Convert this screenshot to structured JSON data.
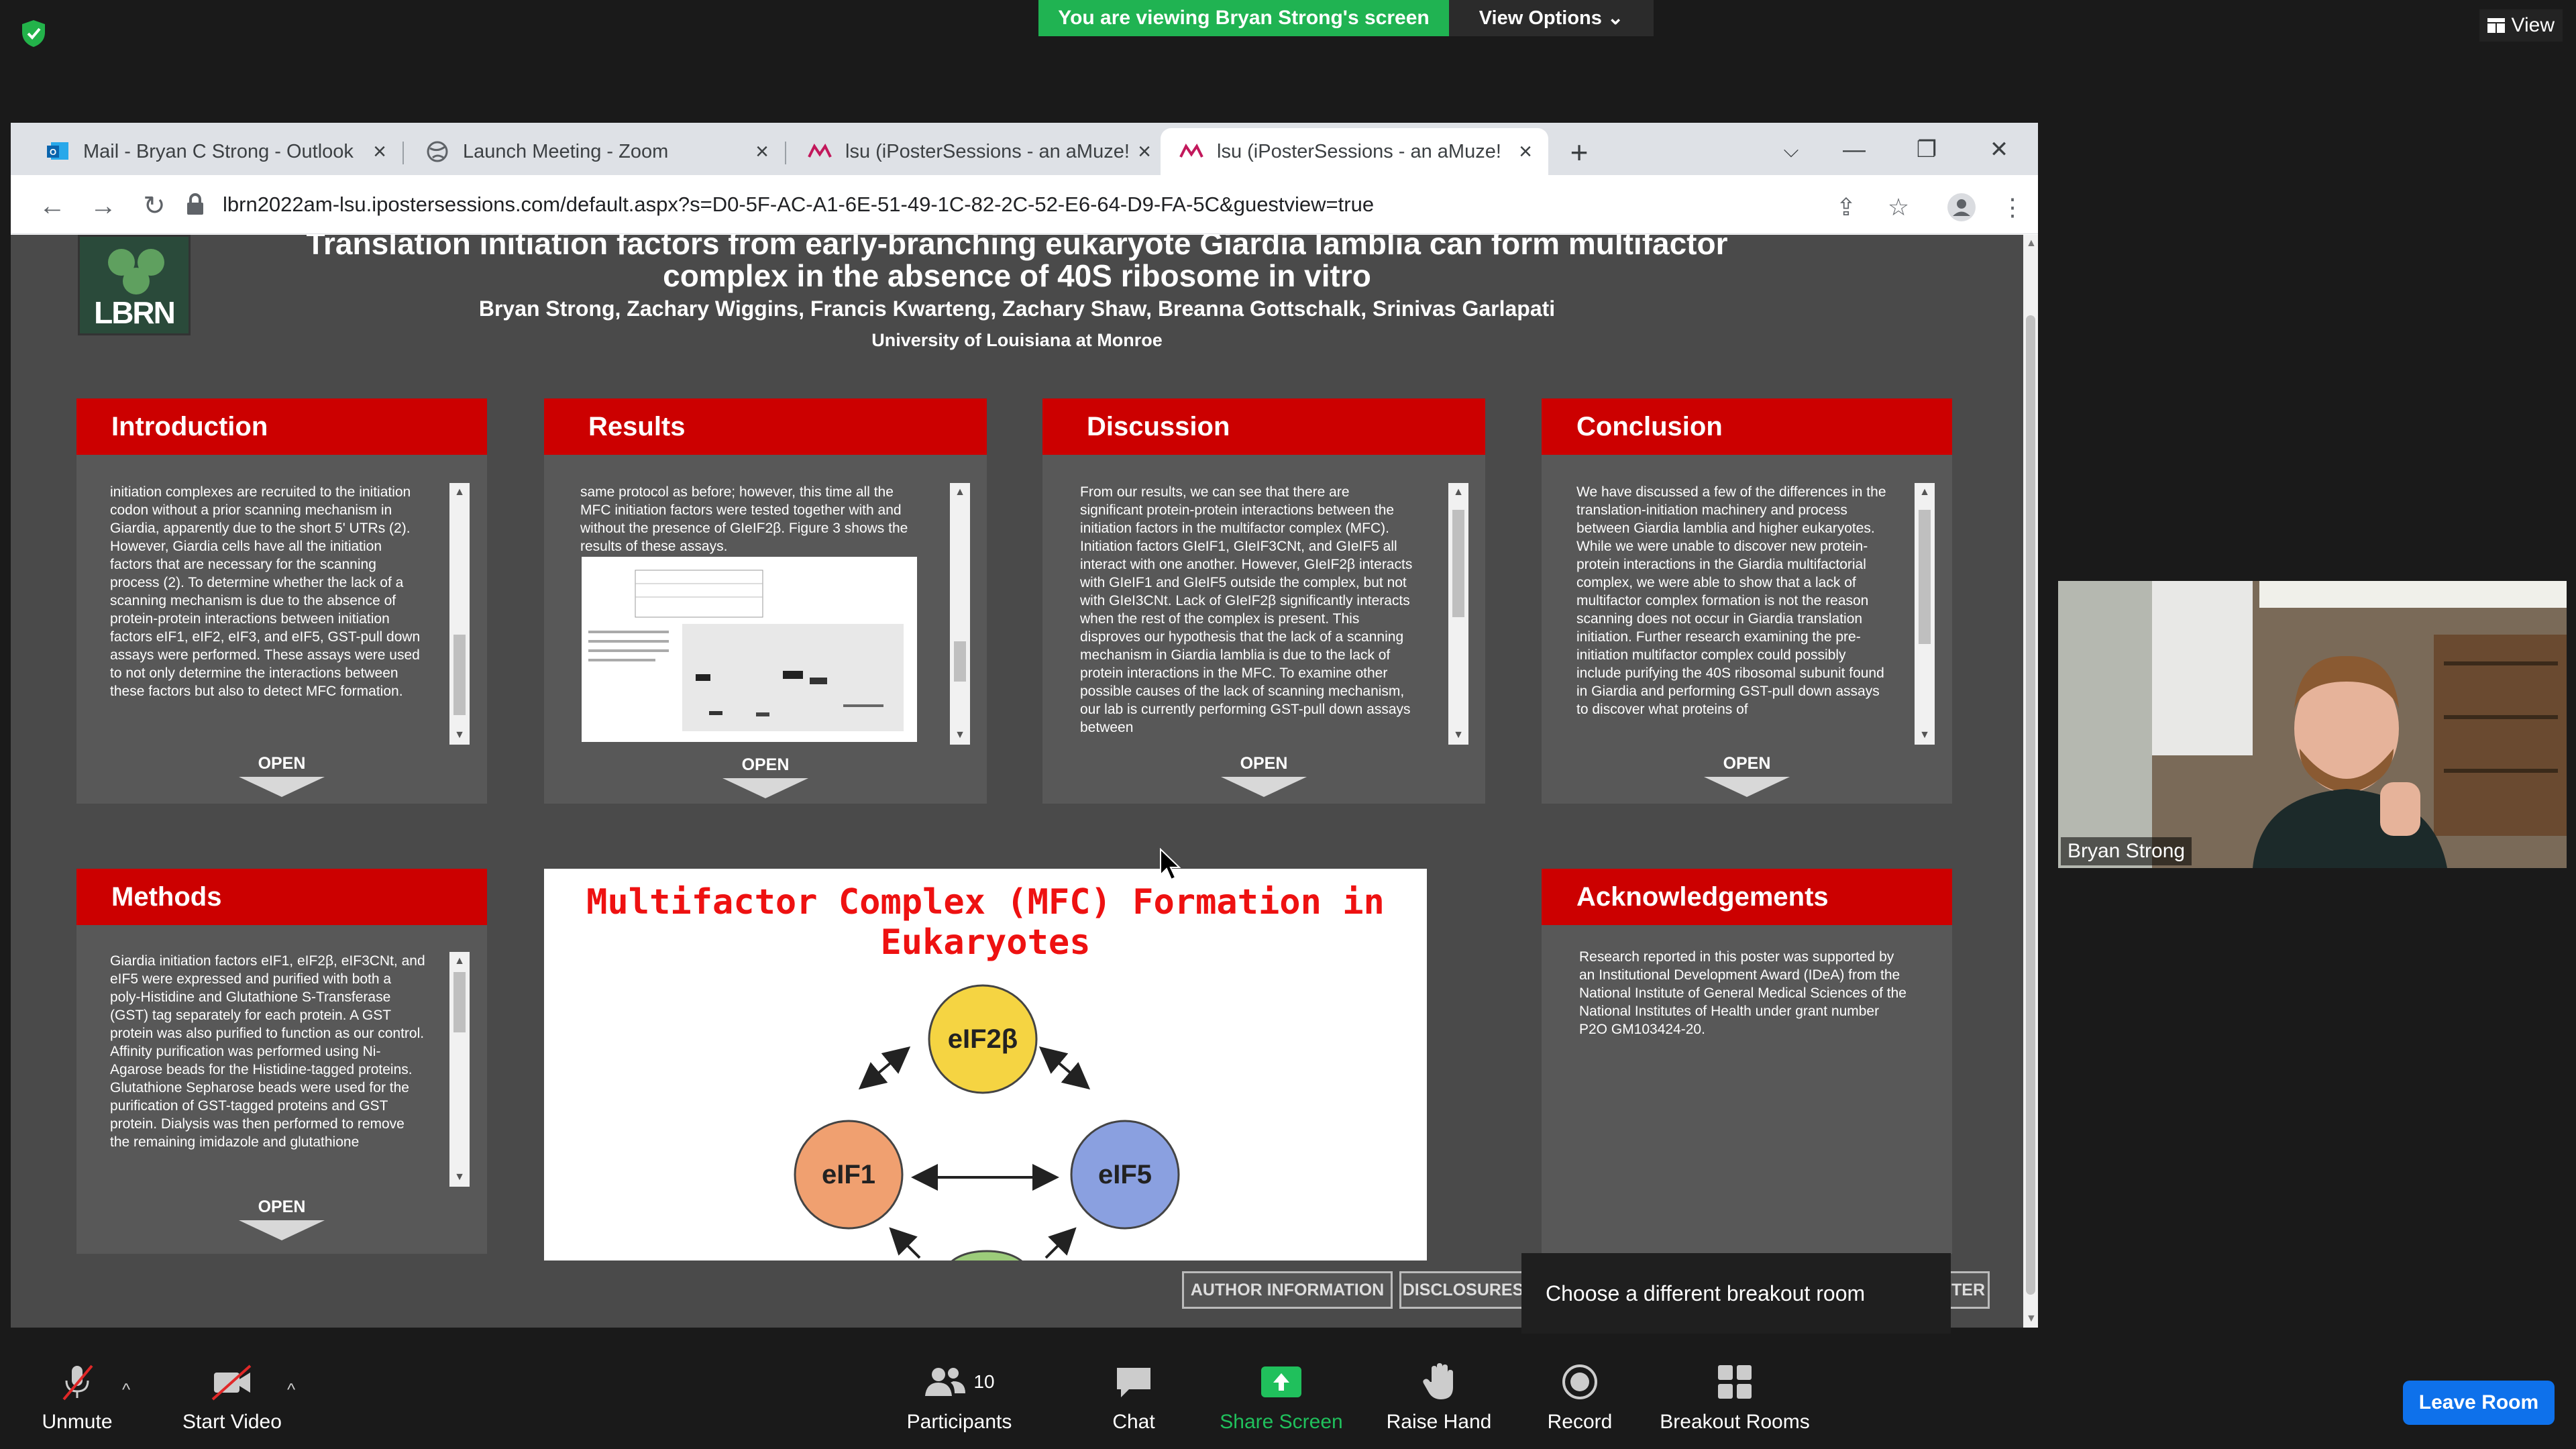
{
  "zoom": {
    "share_banner": "You are viewing Bryan Strong's screen",
    "view_options": "View Options",
    "view_label": "View",
    "tooltip": "Choose a different breakout room",
    "participants_count": "10",
    "buttons": {
      "unmute": "Unmute",
      "start_video": "Start Video",
      "participants": "Participants",
      "chat": "Chat",
      "share_screen": "Share Screen",
      "raise_hand": "Raise Hand",
      "record": "Record",
      "breakout_rooms": "Breakout Rooms",
      "leave_room": "Leave Room"
    },
    "video_name": "Bryan Strong",
    "colors": {
      "share_green": "#20b352",
      "leave_blue": "#0e71eb"
    }
  },
  "browser": {
    "tabs": [
      {
        "title": "Mail - Bryan C Strong - Outlook",
        "icon": "outlook-icon"
      },
      {
        "title": "Launch Meeting - Zoom",
        "icon": "globe-icon"
      },
      {
        "title": "lsu (iPosterSessions - an aMuze!",
        "icon": "imuze-icon"
      },
      {
        "title": "lsu (iPosterSessions - an aMuze!",
        "icon": "imuze-icon"
      }
    ],
    "url": "lbrn2022am-lsu.ipostersessions.com/default.aspx?s=D0-5F-AC-A1-6E-51-49-1C-82-2C-52-E6-64-D9-FA-5C&guestview=true"
  },
  "poster": {
    "title_line1": "Translation initiation factors from early-branching eukaryote Giardia lamblia can form multifactor",
    "title_line2": "complex in the absence of 40S ribosome in vitro",
    "authors": "Bryan Strong, Zachary Wiggins, Francis Kwarteng, Zachary Shaw, Breanna Gottschalk, Srinivas Garlapati",
    "affiliation": "University of Louisiana at Monroe",
    "logo_text": "LBRN",
    "open_label": "OPEN",
    "sections": {
      "introduction": {
        "title": "Introduction",
        "text": "initiation complexes are recruited to the initiation codon without a prior scanning mechanism in Giardia, apparently due to the short 5' UTRs (2). However, Giardia cells have all the initiation factors that are necessary for the scanning process (2). To determine whether the lack of a scanning mechanism is due to the absence of protein-protein interactions between initiation factors eIF1, eIF2, eIF3, and eIF5, GST-pull down assays were performed. These assays were used to not only determine the interactions between these factors but also to detect MFC formation."
      },
      "results": {
        "title": "Results",
        "text": "same protocol as before; however, this time all the MFC initiation factors were tested together with and without the presence of GIeIF2β. Figure 3 shows the results of these assays."
      },
      "discussion": {
        "title": "Discussion",
        "text": "From our results, we can see that there are significant protein-protein interactions between the initiation factors in the multifactor complex (MFC). Initiation factors GIeIF1, GIeIF3CNt, and GIeIF5 all interact with one another. However, GIeIF2β interacts with GIeIF1 and GIeIF5 outside the complex, but not with GIeI3CNt. Lack of GIeIF2β significantly interacts when the rest of the complex is present. This disproves our hypothesis that the lack of a scanning mechanism in Giardia lamblia is due to the lack of protein interactions in the MFC. To examine other possible causes of the lack of scanning mechanism, our lab is currently performing GST-pull down assays between"
      },
      "conclusion": {
        "title": "Conclusion",
        "text": "We have discussed a few of the differences in the translation-initiation machinery and process between Giardia lamblia and higher eukaryotes. While we were unable to discover new protein-protein interactions in the Giardia multifactorial complex, we were able to show that a lack of multifactor complex formation is not the reason scanning does not occur in Giardia translation initiation. Further research examining the pre-initiation multifactor complex could possibly include purifying the 40S ribosomal subunit found in Giardia and performing GST-pull down assays to discover what proteins of"
      },
      "methods": {
        "title": "Methods",
        "text": "Giardia initiation factors eIF1, eIF2β, eIF3CNt, and eIF5 were expressed and purified with both a poly-Histidine and Glutathione S-Transferase (GST) tag separately for each protein. A GST protein was also purified to function as our control. Affinity purification was performed using Ni-Agarose beads for the Histidine-tagged proteins. Glutathione Sepharose beads were used for the purification of GST-tagged proteins and GST protein. Dialysis was then performed to remove the remaining imidazole and glutathione"
      },
      "acknowledgements": {
        "title": "Acknowledgements",
        "text": "Research reported in this poster was supported by an Institutional Development Award (IDeA) from the National Institute of General Medical Sciences of the National Institutes of Health under grant number P2O GM103424-20."
      }
    },
    "mfc": {
      "title": "Multifactor Complex (MFC) Formation in Eukaryotes",
      "nodes": {
        "top": "eIF2β",
        "left": "eIF1",
        "right": "eIF5"
      },
      "colors": {
        "top": "#f5d442",
        "left": "#f0a070",
        "right": "#8aa0e0",
        "bottom": "#9ccc7a"
      }
    },
    "bottom_buttons": {
      "author": "AUTHOR INFORMATION",
      "disclosures": "DISCLOSURES",
      "right_partial": "TER"
    }
  }
}
